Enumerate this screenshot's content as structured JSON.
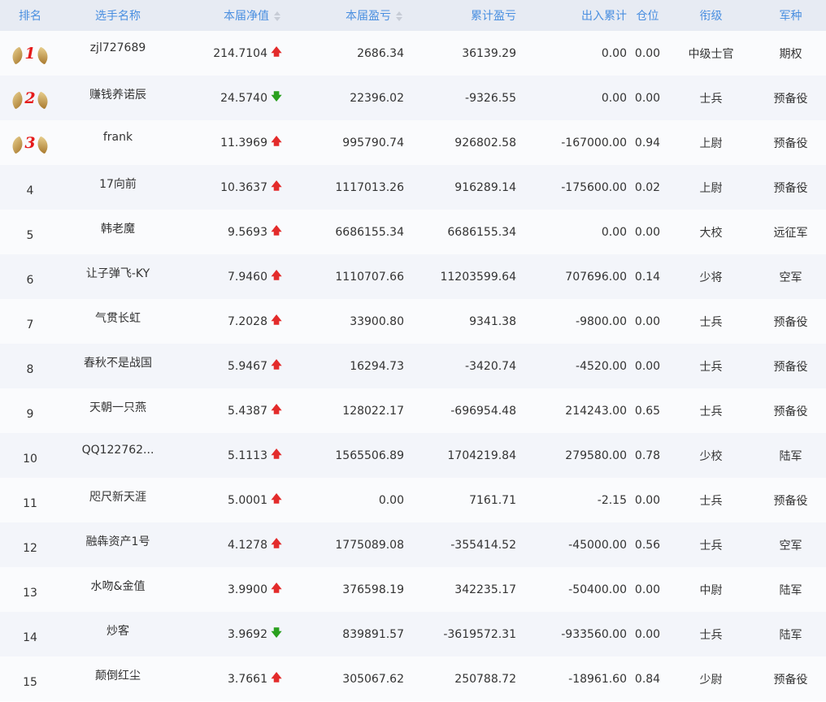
{
  "header": {
    "rank": "排名",
    "player": "选手名称",
    "nav": "本届净值",
    "profit": "本届盈亏",
    "cum_profit": "累计盈亏",
    "inout": "出入累计",
    "position": "仓位",
    "title": "衔级",
    "branch": "军种"
  },
  "colors": {
    "header_text": "#4a8fe0",
    "up_arrow": "#e32b2b",
    "down_arrow": "#2aa01e",
    "medal_number": "#e51b1b"
  },
  "rows": [
    {
      "rank": "1",
      "medal": true,
      "name": "zjl727689",
      "nav": "214.7104",
      "trend": "up",
      "arrow": "🡅",
      "profit": "2686.34",
      "cum": "36139.29",
      "inout": "0.00",
      "pos": "0.00",
      "title": "中级士官",
      "branch": "期权"
    },
    {
      "rank": "2",
      "medal": true,
      "name": "赚钱养诺辰",
      "nav": "24.5740",
      "trend": "down",
      "arrow": "🡇",
      "profit": "22396.02",
      "cum": "-9326.55",
      "inout": "0.00",
      "pos": "0.00",
      "title": "士兵",
      "branch": "预备役"
    },
    {
      "rank": "3",
      "medal": true,
      "name": "frank",
      "nav": "11.3969",
      "trend": "up",
      "arrow": "🡅",
      "profit": "995790.74",
      "cum": "926802.58",
      "inout": "-167000.00",
      "pos": "0.94",
      "title": "上尉",
      "branch": "预备役"
    },
    {
      "rank": "4",
      "medal": false,
      "name": "17向前",
      "nav": "10.3637",
      "trend": "up",
      "arrow": "🡅",
      "profit": "1117013.26",
      "cum": "916289.14",
      "inout": "-175600.00",
      "pos": "0.02",
      "title": "上尉",
      "branch": "预备役"
    },
    {
      "rank": "5",
      "medal": false,
      "name": "韩老魔",
      "nav": "9.5693",
      "trend": "up",
      "arrow": "🡅",
      "profit": "6686155.34",
      "cum": "6686155.34",
      "inout": "0.00",
      "pos": "0.00",
      "title": "大校",
      "branch": "远征军"
    },
    {
      "rank": "6",
      "medal": false,
      "name": "让子弹飞-KY",
      "nav": "7.9460",
      "trend": "up",
      "arrow": "🡅",
      "profit": "1110707.66",
      "cum": "11203599.64",
      "inout": "707696.00",
      "pos": "0.14",
      "title": "少将",
      "branch": "空军"
    },
    {
      "rank": "7",
      "medal": false,
      "name": "气贯长虹",
      "nav": "7.2028",
      "trend": "up",
      "arrow": "🡅",
      "profit": "33900.80",
      "cum": "9341.38",
      "inout": "-9800.00",
      "pos": "0.00",
      "title": "士兵",
      "branch": "预备役"
    },
    {
      "rank": "8",
      "medal": false,
      "name": "春秋不是战国",
      "nav": "5.9467",
      "trend": "up",
      "arrow": "🡅",
      "profit": "16294.73",
      "cum": "-3420.74",
      "inout": "-4520.00",
      "pos": "0.00",
      "title": "士兵",
      "branch": "预备役"
    },
    {
      "rank": "9",
      "medal": false,
      "name": "天朝一只燕",
      "nav": "5.4387",
      "trend": "up",
      "arrow": "🡅",
      "profit": "128022.17",
      "cum": "-696954.48",
      "inout": "214243.00",
      "pos": "0.65",
      "title": "士兵",
      "branch": "预备役"
    },
    {
      "rank": "10",
      "medal": false,
      "name": "QQ122762...",
      "nav": "5.1113",
      "trend": "up",
      "arrow": "🡅",
      "profit": "1565506.89",
      "cum": "1704219.84",
      "inout": "279580.00",
      "pos": "0.78",
      "title": "少校",
      "branch": "陆军"
    },
    {
      "rank": "11",
      "medal": false,
      "name": "咫尺新天涯",
      "nav": "5.0001",
      "trend": "up",
      "arrow": "🡅",
      "profit": "0.00",
      "cum": "7161.71",
      "inout": "-2.15",
      "pos": "0.00",
      "title": "士兵",
      "branch": "预备役"
    },
    {
      "rank": "12",
      "medal": false,
      "name": "融犇资产1号",
      "nav": "4.1278",
      "trend": "up",
      "arrow": "🡅",
      "profit": "1775089.08",
      "cum": "-355414.52",
      "inout": "-45000.00",
      "pos": "0.56",
      "title": "士兵",
      "branch": "空军"
    },
    {
      "rank": "13",
      "medal": false,
      "name": "水吻&金值",
      "nav": "3.9900",
      "trend": "up",
      "arrow": "🡅",
      "profit": "376598.19",
      "cum": "342235.17",
      "inout": "-50400.00",
      "pos": "0.00",
      "title": "中尉",
      "branch": "陆军"
    },
    {
      "rank": "14",
      "medal": false,
      "name": "炒客",
      "nav": "3.9692",
      "trend": "down",
      "arrow": "🡇",
      "profit": "839891.57",
      "cum": "-3619572.31",
      "inout": "-933560.00",
      "pos": "0.00",
      "title": "士兵",
      "branch": "陆军"
    },
    {
      "rank": "15",
      "medal": false,
      "name": "颠倒红尘",
      "nav": "3.7661",
      "trend": "up",
      "arrow": "🡅",
      "profit": "305067.62",
      "cum": "250788.72",
      "inout": "-18961.60",
      "pos": "0.84",
      "title": "少尉",
      "branch": "预备役"
    }
  ]
}
